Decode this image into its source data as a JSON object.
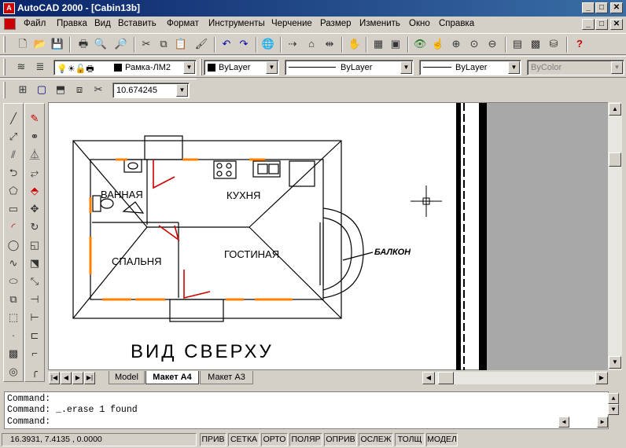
{
  "window": {
    "title": "AutoCAD 2000 - [Cabin13b]",
    "minimize": "_",
    "maximize": "□",
    "close": "✕"
  },
  "menu": [
    "Файл",
    "Правка",
    "Вид",
    "Вставить",
    "Формат",
    "Инструменты",
    "Черчение",
    "Размер",
    "Изменить",
    "Окно",
    "Справка"
  ],
  "layers_toolbar": {
    "layer_name": "Рамка-ЛМ2",
    "color": "ByLayer",
    "linetype": "ByLayer",
    "lineweight": "ByLayer",
    "plotstyle": "ByColor"
  },
  "viewport_toolbar": {
    "scale_value": "10.674245"
  },
  "drawing": {
    "rooms": {
      "bathroom": "ВАННАЯ",
      "kitchen": "КУХНЯ",
      "bedroom": "СПАЛЬНЯ",
      "living": "ГОСТИНАЯ",
      "balcony": "БАЛКОН"
    },
    "view_title": "ВИД СВЕРХУ"
  },
  "tabs": [
    {
      "label": "Model",
      "active": false
    },
    {
      "label": "Макет А4",
      "active": true
    },
    {
      "label": "Макет А3",
      "active": false
    }
  ],
  "command": {
    "line1": "Command:",
    "line2": "Command: _.erase 1 found",
    "line3": "Command:"
  },
  "status": {
    "coords": "16.3931, 7.4135 , 0.0000",
    "buttons": [
      "ПРИВ",
      "СЕТКА",
      "ОРТО",
      "ПОЛЯР",
      "ОПРИВ",
      "ОСЛЕЖ",
      "ТОЛЩ",
      "МОДЕЛ"
    ]
  },
  "colors": {
    "title_bar": "#0a246a",
    "window_red": "#cc0000",
    "frame_orange": "#ff8000"
  }
}
